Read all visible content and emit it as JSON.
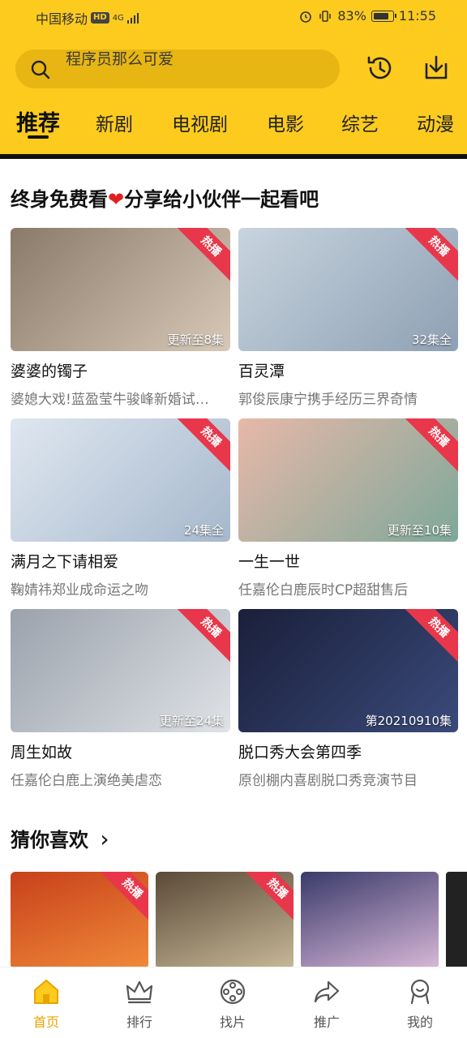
{
  "status_bar": {
    "carrier": "中国移动",
    "hd": "HD",
    "network": "4G",
    "battery": "83%",
    "battery_level": 0.83,
    "time": "11:55"
  },
  "search": {
    "text": "程序员那么可爱"
  },
  "tabs": [
    {
      "label": "推荐",
      "active": true
    },
    {
      "label": "新剧"
    },
    {
      "label": "电视剧"
    },
    {
      "label": "电影"
    },
    {
      "label": "综艺"
    },
    {
      "label": "动漫"
    }
  ],
  "section1": {
    "title_pre": "终身免费看",
    "heart": "❤",
    "title_post": "分享给小伙伴一起看吧"
  },
  "cards": [
    {
      "title": "婆婆的镯子",
      "subtitle": "婆媳大戏!蓝盈莹牛骏峰新婚试…",
      "episodes": "更新至8集",
      "badge": "热播",
      "color1": "#8a7a6a",
      "color2": "#d8c8b8"
    },
    {
      "title": "百灵潭",
      "subtitle": "郭俊辰康宁携手经历三界奇情",
      "episodes": "32集全",
      "badge": "热播",
      "color1": "#c8d4de",
      "color2": "#8ea0b4"
    },
    {
      "title": "满月之下请相爱",
      "subtitle": "鞠婧祎郑业成命运之吻",
      "episodes": "24集全",
      "badge": "热播",
      "color1": "#dfe7f0",
      "color2": "#a6b8cc"
    },
    {
      "title": "一生一世",
      "subtitle": "任嘉伦白鹿辰时CP超甜售后",
      "episodes": "更新至10集",
      "badge": "热播",
      "color1": "#e7b8a8",
      "color2": "#7ea89a"
    },
    {
      "title": "周生如故",
      "subtitle": "任嘉伦白鹿上演绝美虐恋",
      "episodes": "更新至24集",
      "badge": "热播",
      "color1": "#9aa2ac",
      "color2": "#dfe2e6"
    },
    {
      "title": "脱口秀大会第四季",
      "subtitle": "原创棚内喜剧脱口秀竞演节目",
      "episodes": "第20210910集",
      "badge": "热播",
      "color1": "#1a1f3a",
      "color2": "#3a4a7a"
    }
  ],
  "section2": {
    "title": "猜你喜欢",
    "arrow": "›"
  },
  "small_cards": [
    {
      "badge": "热播",
      "color1": "#c8401a",
      "color2": "#f08a3a"
    },
    {
      "badge": "热播",
      "color1": "#5a4a38",
      "color2": "#c8b898"
    },
    {
      "badge": "",
      "color1": "#3a3a6a",
      "color2": "#d8b8d8"
    }
  ],
  "bottom_nav": [
    {
      "label": "首页",
      "icon": "home-icon",
      "active": true
    },
    {
      "label": "排行",
      "icon": "crown-icon"
    },
    {
      "label": "找片",
      "icon": "film-reel-icon"
    },
    {
      "label": "推广",
      "icon": "share-arrow-icon"
    },
    {
      "label": "我的",
      "icon": "profile-icon"
    }
  ],
  "colors": {
    "header": "#FDCB1E",
    "search_bg": "#E8B613",
    "hot_badge": "#E8374A",
    "active_nav": "#E8A400"
  }
}
